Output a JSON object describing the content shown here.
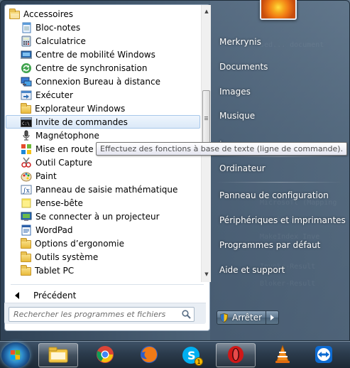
{
  "programs": {
    "folder_label": "Accessoires",
    "items": [
      {
        "label": "Bloc-notes",
        "icon": "notepad-icon"
      },
      {
        "label": "Calculatrice",
        "icon": "calculator-icon"
      },
      {
        "label": "Centre de mobilité Windows",
        "icon": "mobility-center-icon"
      },
      {
        "label": "Centre de synchronisation",
        "icon": "sync-center-icon"
      },
      {
        "label": "Connexion Bureau à distance",
        "icon": "remote-desktop-icon"
      },
      {
        "label": "Exécuter",
        "icon": "run-icon"
      },
      {
        "label": "Explorateur Windows",
        "icon": "explorer-icon"
      },
      {
        "label": "Invite de commandes",
        "icon": "command-prompt-icon",
        "selected": true
      },
      {
        "label": "Magnétophone",
        "icon": "microphone-icon"
      },
      {
        "label": "Mise en route",
        "icon": "getting-started-icon"
      },
      {
        "label": "Outil Capture",
        "icon": "snipping-tool-icon"
      },
      {
        "label": "Paint",
        "icon": "paint-icon"
      },
      {
        "label": "Panneau de saisie mathématique",
        "icon": "math-input-icon"
      },
      {
        "label": "Pense-bête",
        "icon": "sticky-notes-icon"
      },
      {
        "label": "Se connecter à un projecteur",
        "icon": "projector-icon"
      },
      {
        "label": "WordPad",
        "icon": "wordpad-icon"
      },
      {
        "label": "Options d’ergonomie",
        "icon": "folder-icon"
      },
      {
        "label": "Outils système",
        "icon": "folder-icon"
      },
      {
        "label": "Tablet PC",
        "icon": "folder-icon"
      }
    ],
    "back_label": "Précédent"
  },
  "tooltip": "Effectuez des fonctions à base de texte (ligne de commande).",
  "search": {
    "placeholder": "Rechercher les programmes et fichiers"
  },
  "right_pane": {
    "items": [
      "Merkrynis",
      "Documents",
      "Images",
      "Musique",
      "Ordinateur",
      "Panneau de configuration",
      "Périphériques et imprimantes",
      "Programmes par défaut",
      "Aide et support"
    ]
  },
  "shutdown": {
    "label": "Arrêter"
  },
  "taskbar": {
    "apps": [
      "explorer-icon",
      "chrome-icon",
      "firefox-icon",
      "skype-icon",
      "opera-icon",
      "vlc-icon",
      "teamviewer-icon"
    ],
    "skype_badge": "1"
  },
  "colors": {
    "selection": "#dbe9f8",
    "taskbar": "#2b3b4c",
    "opera_red": "#d01818"
  }
}
